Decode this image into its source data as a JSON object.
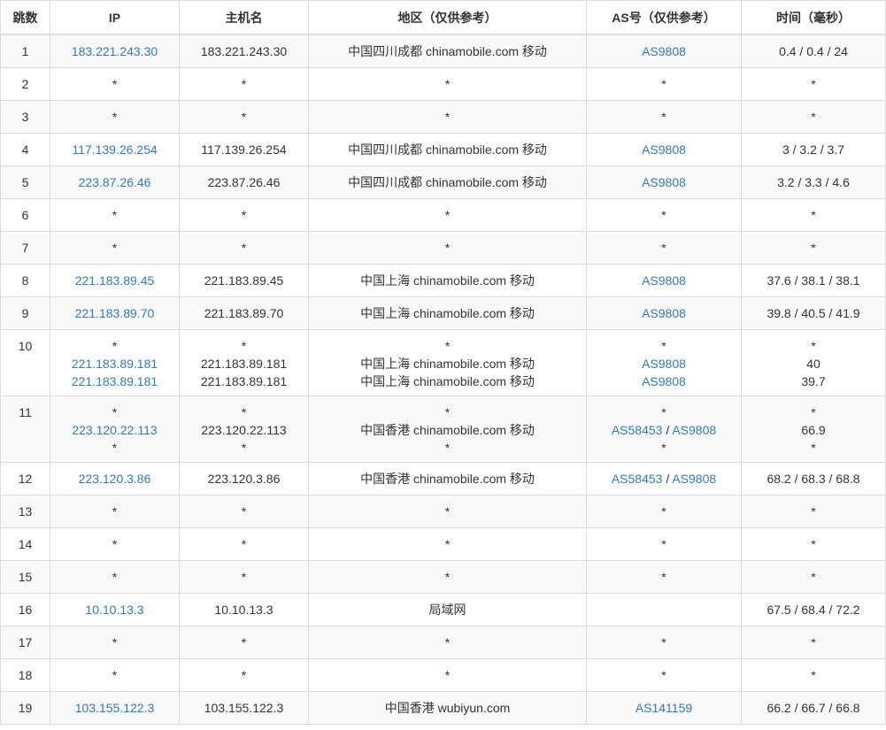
{
  "colors": {
    "link": "#337ab7",
    "text": "#333333",
    "border": "#dddddd",
    "stripe": "#f9f9f9"
  },
  "headers": [
    "跳数",
    "IP",
    "主机名",
    "地区（仅供参考）",
    "AS号（仅供参考）",
    "时间（毫秒）"
  ],
  "rows": [
    {
      "hop": "1",
      "lines": [
        {
          "ip": "183.221.243.30",
          "host": "183.221.243.30",
          "region": "中国四川成都 chinamobile.com 移动",
          "as": [
            "AS9808"
          ],
          "time": "0.4 / 0.4 / 24"
        }
      ]
    },
    {
      "hop": "2",
      "lines": [
        {
          "ip": "*",
          "host": "*",
          "region": "*",
          "as": [
            "*"
          ],
          "time": "*"
        }
      ]
    },
    {
      "hop": "3",
      "lines": [
        {
          "ip": "*",
          "host": "*",
          "region": "*",
          "as": [
            "*"
          ],
          "time": "*"
        }
      ]
    },
    {
      "hop": "4",
      "lines": [
        {
          "ip": "117.139.26.254",
          "host": "117.139.26.254",
          "region": "中国四川成都 chinamobile.com 移动",
          "as": [
            "AS9808"
          ],
          "time": "3 / 3.2 / 3.7"
        }
      ]
    },
    {
      "hop": "5",
      "lines": [
        {
          "ip": "223.87.26.46",
          "host": "223.87.26.46",
          "region": "中国四川成都 chinamobile.com 移动",
          "as": [
            "AS9808"
          ],
          "time": "3.2 / 3.3 / 4.6"
        }
      ]
    },
    {
      "hop": "6",
      "lines": [
        {
          "ip": "*",
          "host": "*",
          "region": "*",
          "as": [
            "*"
          ],
          "time": "*"
        }
      ]
    },
    {
      "hop": "7",
      "lines": [
        {
          "ip": "*",
          "host": "*",
          "region": "*",
          "as": [
            "*"
          ],
          "time": "*"
        }
      ]
    },
    {
      "hop": "8",
      "lines": [
        {
          "ip": "221.183.89.45",
          "host": "221.183.89.45",
          "region": "中国上海 chinamobile.com 移动",
          "as": [
            "AS9808"
          ],
          "time": "37.6 / 38.1 / 38.1"
        }
      ]
    },
    {
      "hop": "9",
      "lines": [
        {
          "ip": "221.183.89.70",
          "host": "221.183.89.70",
          "region": "中国上海 chinamobile.com 移动",
          "as": [
            "AS9808"
          ],
          "time": "39.8 / 40.5 / 41.9"
        }
      ]
    },
    {
      "hop": "10",
      "lines": [
        {
          "ip": "*",
          "host": "*",
          "region": "*",
          "as": [
            "*"
          ],
          "time": "*"
        },
        {
          "ip": "221.183.89.181",
          "host": "221.183.89.181",
          "region": "中国上海 chinamobile.com 移动",
          "as": [
            "AS9808"
          ],
          "time": "40"
        },
        {
          "ip": "221.183.89.181",
          "host": "221.183.89.181",
          "region": "中国上海 chinamobile.com 移动",
          "as": [
            "AS9808"
          ],
          "time": "39.7"
        }
      ]
    },
    {
      "hop": "11",
      "lines": [
        {
          "ip": "*",
          "host": "*",
          "region": "*",
          "as": [
            "*"
          ],
          "time": "*"
        },
        {
          "ip": "223.120.22.113",
          "host": "223.120.22.113",
          "region": "中国香港 chinamobile.com 移动",
          "as": [
            "AS58453",
            "AS9808"
          ],
          "time": "66.9"
        },
        {
          "ip": "*",
          "host": "*",
          "region": "*",
          "as": [
            "*"
          ],
          "time": "*"
        }
      ]
    },
    {
      "hop": "12",
      "lines": [
        {
          "ip": "223.120.3.86",
          "host": "223.120.3.86",
          "region": "中国香港 chinamobile.com 移动",
          "as": [
            "AS58453",
            "AS9808"
          ],
          "time": "68.2 / 68.3 / 68.8"
        }
      ]
    },
    {
      "hop": "13",
      "lines": [
        {
          "ip": "*",
          "host": "*",
          "region": "*",
          "as": [
            "*"
          ],
          "time": "*"
        }
      ]
    },
    {
      "hop": "14",
      "lines": [
        {
          "ip": "*",
          "host": "*",
          "region": "*",
          "as": [
            "*"
          ],
          "time": "*"
        }
      ]
    },
    {
      "hop": "15",
      "lines": [
        {
          "ip": "*",
          "host": "*",
          "region": "*",
          "as": [
            "*"
          ],
          "time": "*"
        }
      ]
    },
    {
      "hop": "16",
      "lines": [
        {
          "ip": "10.10.13.3",
          "host": "10.10.13.3",
          "region": "局域网",
          "as": [],
          "time": "67.5 / 68.4 / 72.2"
        }
      ]
    },
    {
      "hop": "17",
      "lines": [
        {
          "ip": "*",
          "host": "*",
          "region": "*",
          "as": [
            "*"
          ],
          "time": "*"
        }
      ]
    },
    {
      "hop": "18",
      "lines": [
        {
          "ip": "*",
          "host": "*",
          "region": "*",
          "as": [
            "*"
          ],
          "time": "*"
        }
      ]
    },
    {
      "hop": "19",
      "lines": [
        {
          "ip": "103.155.122.3",
          "host": "103.155.122.3",
          "region": "中国香港 wubiyun.com",
          "as": [
            "AS141159"
          ],
          "time": "66.2 / 66.7 / 66.8"
        }
      ]
    }
  ]
}
